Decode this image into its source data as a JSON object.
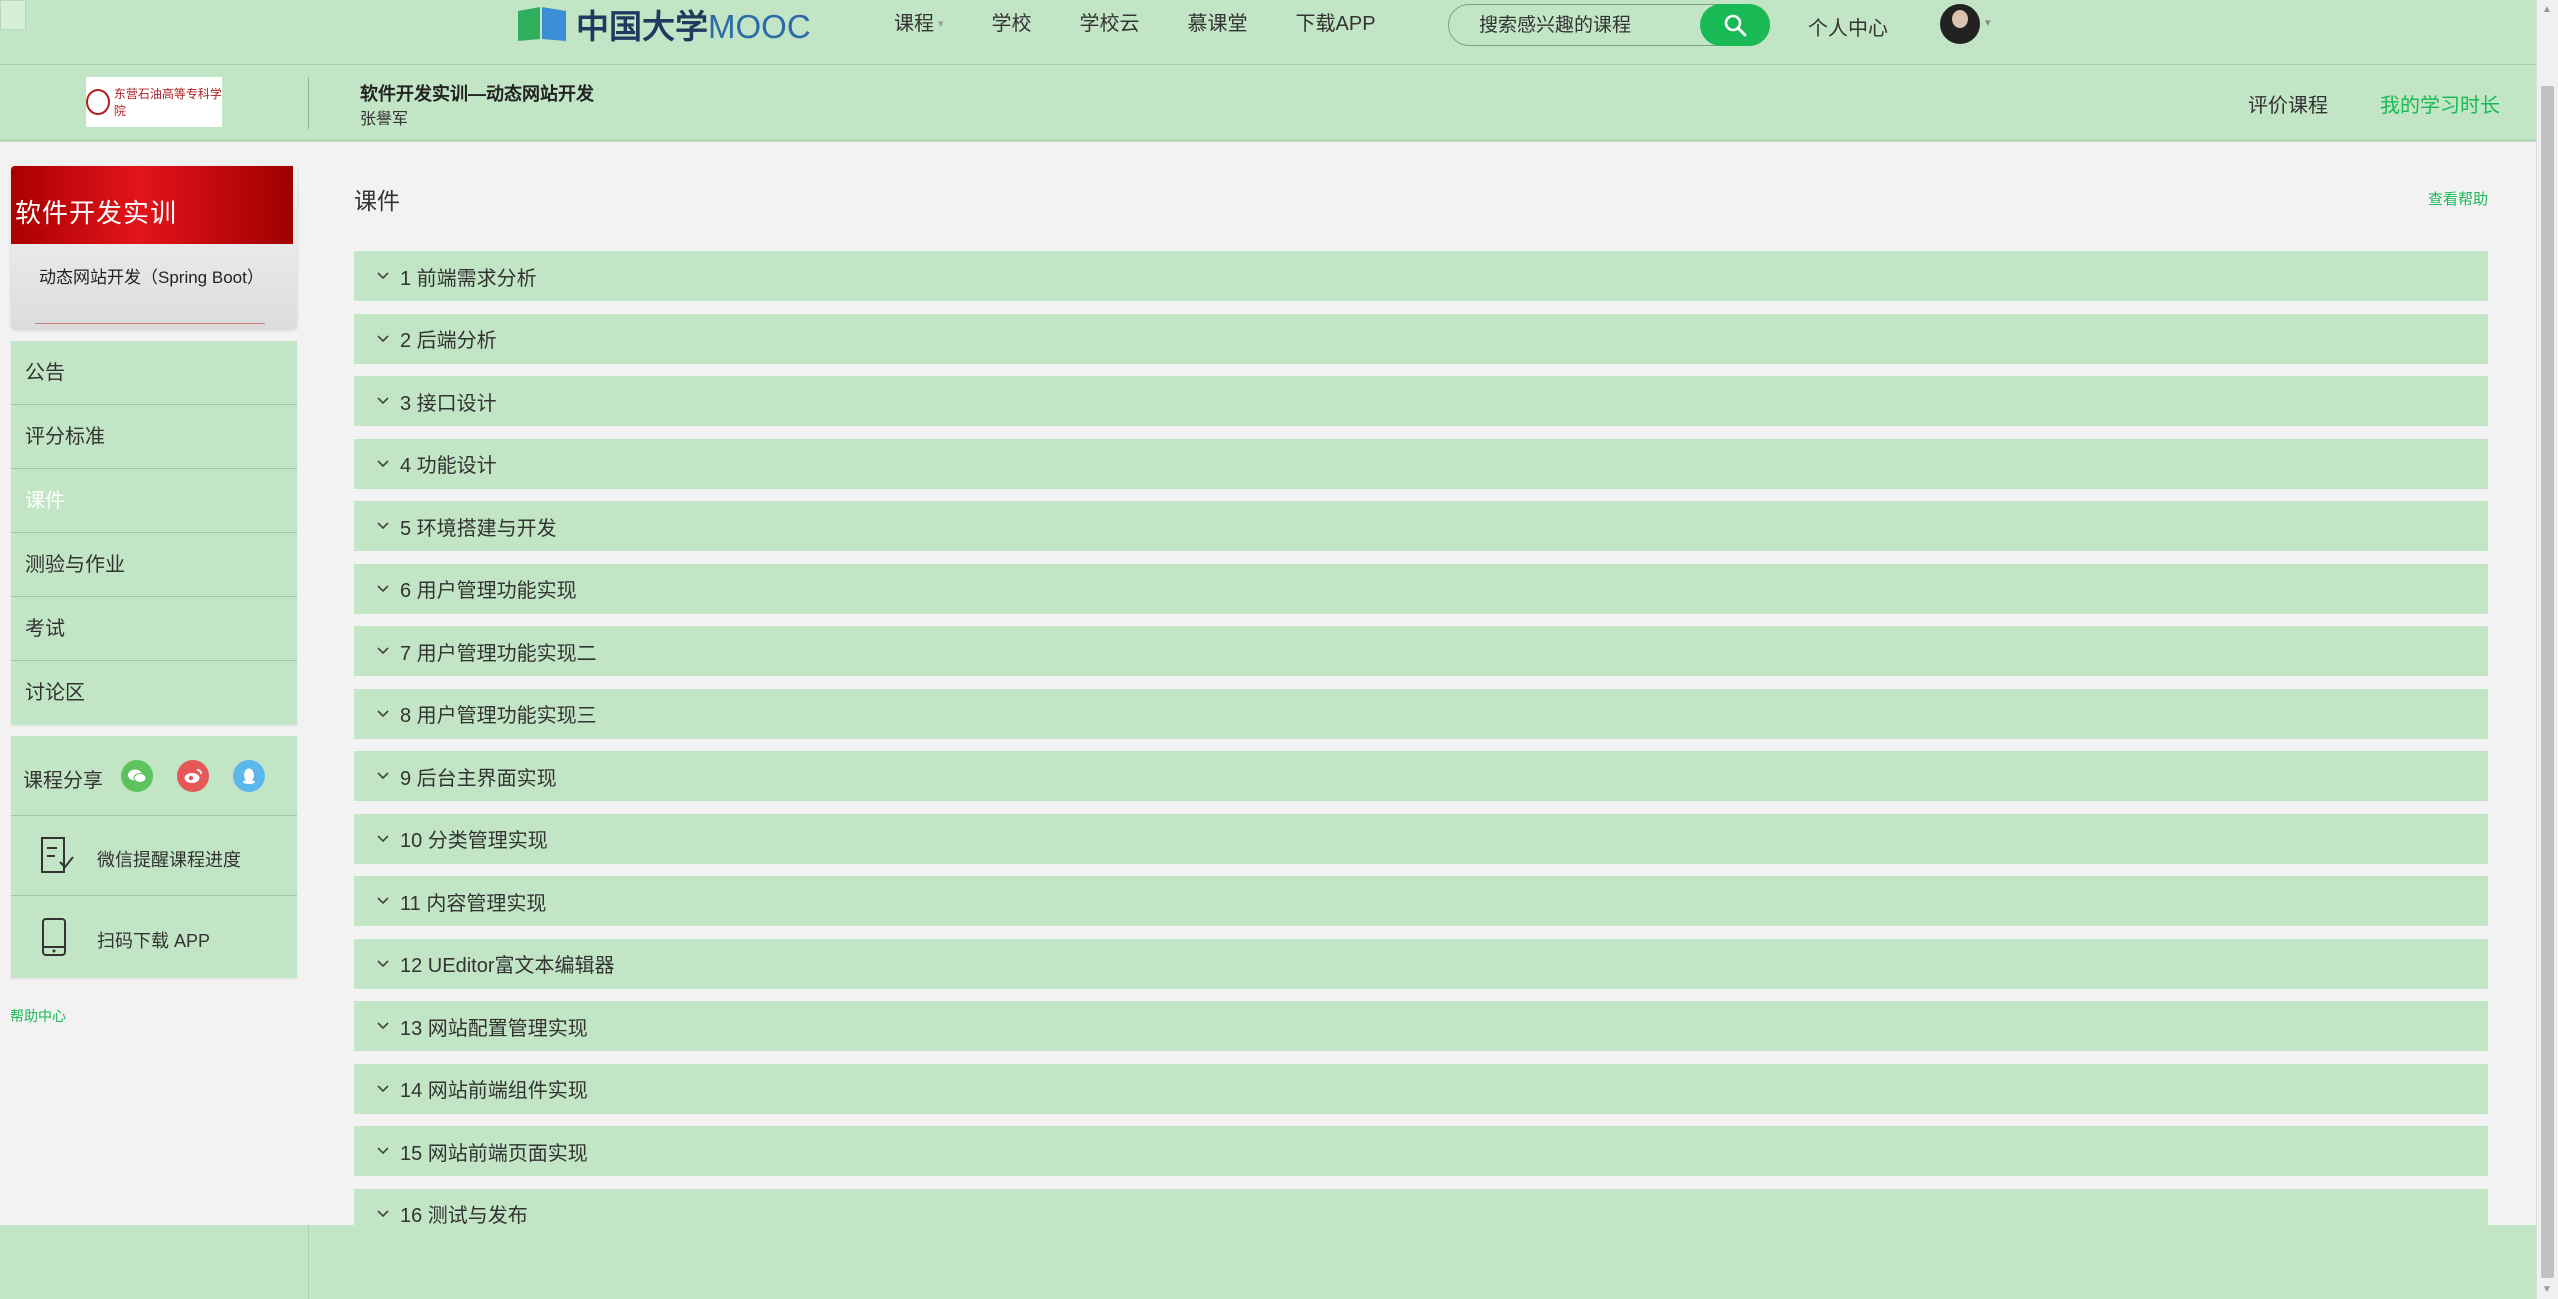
{
  "header": {
    "logo_text": "中国大学",
    "logo_mooc": "MOOC",
    "nav": [
      {
        "label": "课程",
        "has_caret": true
      },
      {
        "label": "学校"
      },
      {
        "label": "学校云"
      },
      {
        "label": "慕课堂"
      },
      {
        "label": "下载APP"
      }
    ],
    "search_placeholder": "搜索感兴趣的课程",
    "personal_center": "个人中心"
  },
  "course": {
    "school_logo_text": "东营石油高等专科学院",
    "title": "软件开发实训—动态网站开发",
    "teacher": "张譽军",
    "rate_course": "评价课程",
    "study_time": "我的学习时长"
  },
  "cover": {
    "title": "软件开发实训",
    "subtitle": "动态网站开发（Spring Boot）"
  },
  "sidebar": {
    "items": [
      {
        "label": "公告",
        "active": false
      },
      {
        "label": "评分标准",
        "active": false
      },
      {
        "label": "课件",
        "active": true
      },
      {
        "label": "测验与作业",
        "active": false
      },
      {
        "label": "考试",
        "active": false
      },
      {
        "label": "讨论区",
        "active": false
      }
    ],
    "share_label": "课程分享",
    "wechat_remind": "微信提醒课程进度",
    "download_app": "扫码下载 APP",
    "help_center": "帮助中心"
  },
  "main": {
    "heading": "课件",
    "view_help": "查看帮助",
    "chapters": [
      "1 前端需求分析",
      "2 后端分析",
      "3 接口设计",
      "4 功能设计",
      "5 环境搭建与开发",
      "6 用户管理功能实现",
      "7 用户管理功能实现二",
      "8 用户管理功能实现三",
      "9 后台主界面实现",
      "10 分类管理实现",
      "11 内容管理实现",
      "12 UEditor富文本编辑器",
      "13 网站配置管理实现",
      "14 网站前端组件实现",
      "15 网站前端页面实现",
      "16 测试与发布"
    ]
  },
  "colors": {
    "accent_green": "#19b955",
    "panel_green": "#c2e5c5",
    "content_bg": "#f2f2f2"
  }
}
